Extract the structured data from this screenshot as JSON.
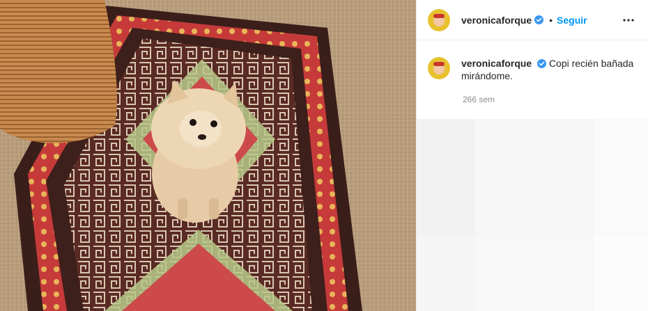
{
  "post": {
    "username": "veronicaforque",
    "follow_label": "Seguir",
    "separator": "•",
    "caption": "Copi recién bañada mirándome.",
    "timestamp": "266 sem"
  },
  "icons": {
    "verified": "verified-badge-icon",
    "more": "more-options-icon"
  },
  "colors": {
    "accent": "#0095f6",
    "verified": "#3897f0",
    "text": "#262626",
    "muted": "#8e8e8e"
  }
}
